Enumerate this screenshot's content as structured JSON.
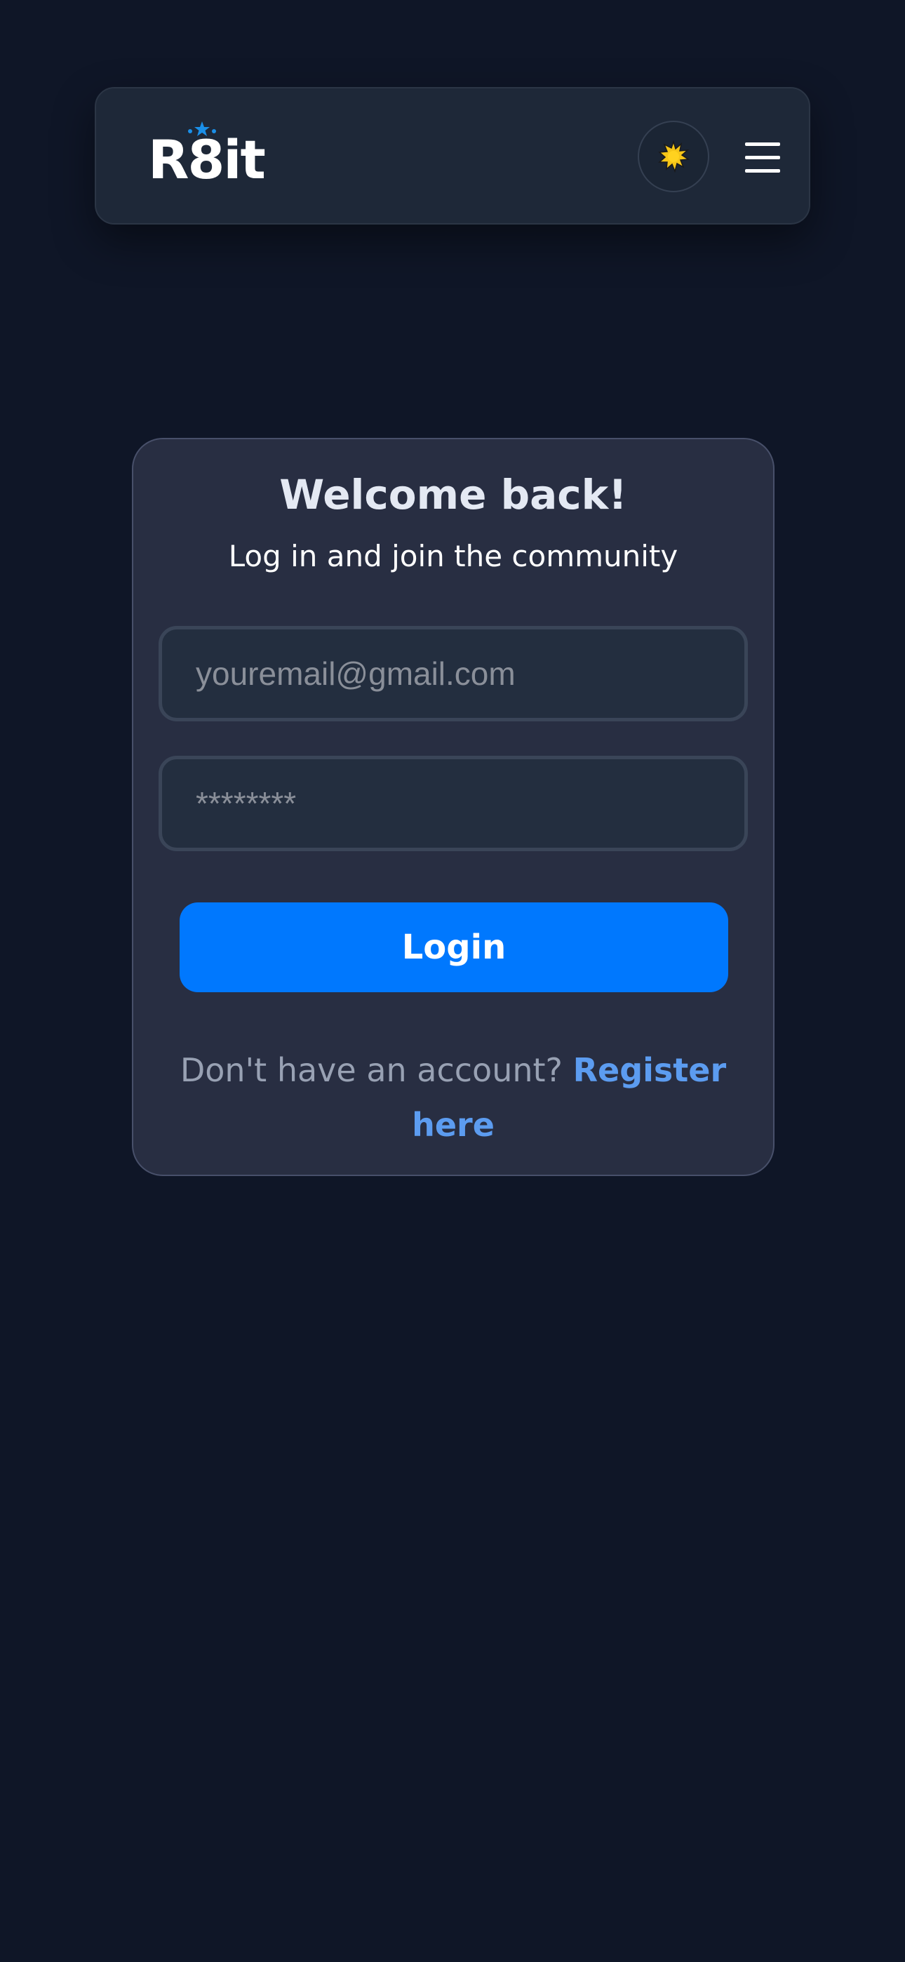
{
  "header": {
    "logo_text": "R8it",
    "theme_icon": "sun-icon",
    "menu_icon": "hamburger-menu-icon"
  },
  "login_card": {
    "title": "Welcome back!",
    "subtitle": "Log in and join the community",
    "email_placeholder": "youremail@gmail.com",
    "password_placeholder": "********",
    "login_label": "Login",
    "register_prompt": "Don't have an account?",
    "register_link": "Register here"
  },
  "colors": {
    "background": "#0f1627",
    "header_bg": "#1e2838",
    "card_bg": "#282e42",
    "accent": "#0078fe",
    "link": "#5c9cf0",
    "sun": "#f5c518"
  }
}
